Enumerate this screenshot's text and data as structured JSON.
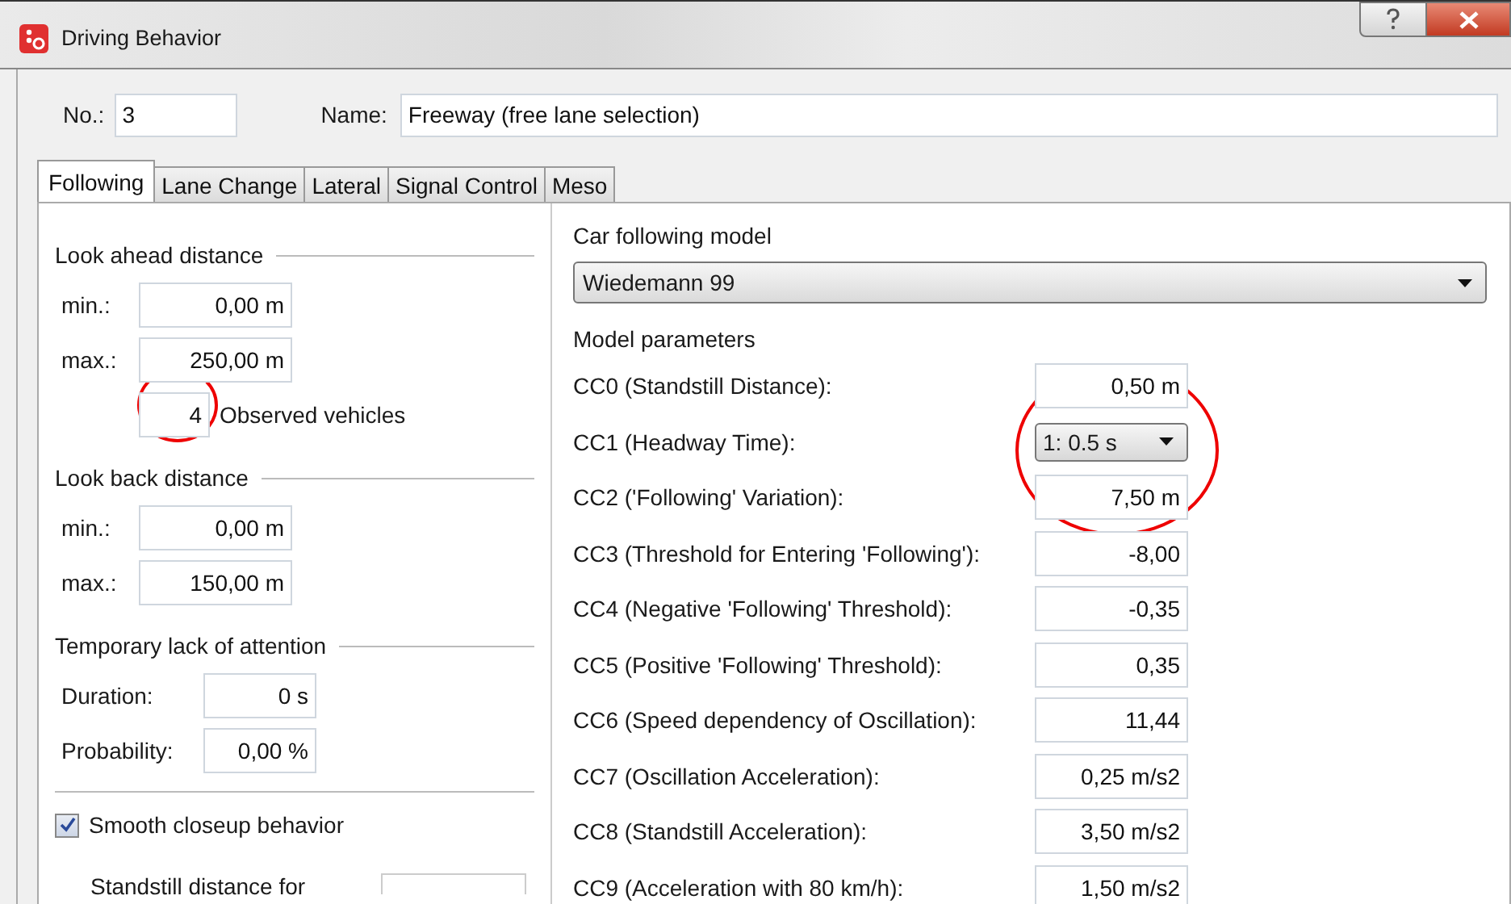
{
  "window": {
    "title": "Driving Behavior"
  },
  "number": {
    "label": "No.:",
    "value": "3"
  },
  "name": {
    "label": "Name:",
    "value": "Freeway (free lane selection)"
  },
  "tabs": [
    {
      "label": "Following",
      "selected": true
    },
    {
      "label": "Lane Change",
      "selected": false
    },
    {
      "label": "Lateral",
      "selected": false
    },
    {
      "label": "Signal Control",
      "selected": false
    },
    {
      "label": "Meso",
      "selected": false
    }
  ],
  "look_ahead": {
    "title": "Look ahead distance",
    "fields": [
      {
        "label": "min.:",
        "value": "0,00 m"
      },
      {
        "label": "max.:",
        "value": "250,00 m"
      }
    ],
    "observed": {
      "value": "4",
      "label": "Observed vehicles"
    }
  },
  "look_back": {
    "title": "Look back distance",
    "fields": [
      {
        "label": "min.:",
        "value": "0,00 m"
      },
      {
        "label": "max.:",
        "value": "150,00 m"
      }
    ]
  },
  "attention": {
    "title": "Temporary lack of attention",
    "fields": [
      {
        "label": "Duration:",
        "value": "0 s"
      },
      {
        "label": "Probability:",
        "value": "0,00 %"
      }
    ]
  },
  "smooth_closeup": {
    "label": "Smooth closeup behavior",
    "checked": true
  },
  "standstill": {
    "label": "Standstill distance for"
  },
  "car_following": {
    "title": "Car following model",
    "model": "Wiedemann 99",
    "params_title": "Model parameters",
    "params": [
      {
        "kind": "field",
        "label": "CC0 (Standstill Distance):",
        "value": "0,50 m"
      },
      {
        "kind": "dropdown",
        "label": "CC1 (Headway Time):",
        "value": "1: 0.5 s"
      },
      {
        "kind": "field",
        "label": "CC2 ('Following' Variation):",
        "value": "7,50 m"
      },
      {
        "kind": "field",
        "label": "CC3 (Threshold for Entering 'Following'):",
        "value": "-8,00"
      },
      {
        "kind": "field",
        "label": "CC4 (Negative 'Following' Threshold):",
        "value": "-0,35"
      },
      {
        "kind": "field",
        "label": "CC5 (Positive 'Following' Threshold):",
        "value": "0,35"
      },
      {
        "kind": "field",
        "label": "CC6 (Speed dependency of Oscillation):",
        "value": "11,44"
      },
      {
        "kind": "field",
        "label": "CC7 (Oscillation Acceleration):",
        "value": "0,25 m/s2"
      },
      {
        "kind": "field",
        "label": "CC8 (Standstill Acceleration):",
        "value": "3,50 m/s2"
      },
      {
        "kind": "field",
        "label": "CC9 (Acceleration with 80 km/h):",
        "value": "1,50 m/s2"
      }
    ]
  }
}
